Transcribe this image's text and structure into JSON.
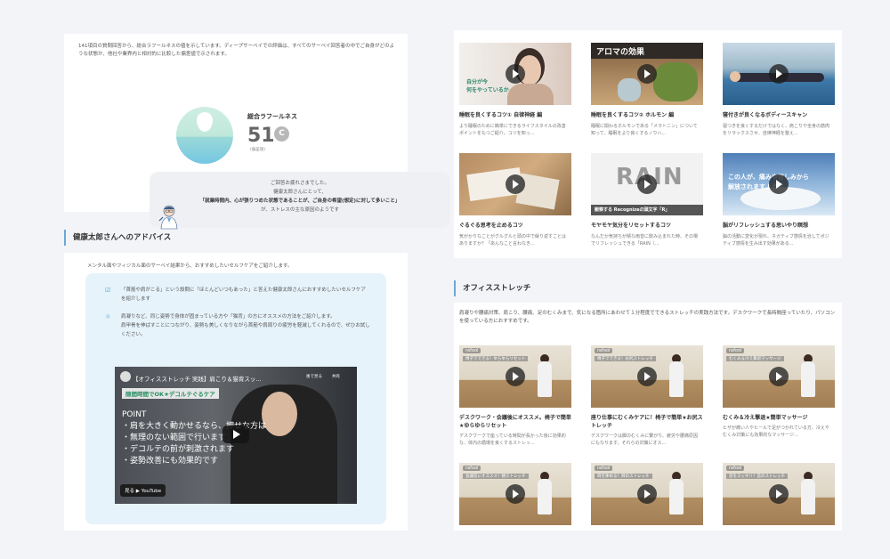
{
  "intro": {
    "description": "141項目の質問回答から、総合ラフールネスの値を示しています。ディープサーベイでの評価は、すべてのサーベイ回答者の中でご自身がどのような状態か、他社や業界内と相対的に比較した偏差値で示されます。",
    "score_label": "総合ラフールネス",
    "score_value": "51",
    "score_grade": "C",
    "score_sub": "(偏差値)",
    "message_line1": "ご回答お疲れさまでした。",
    "message_line2": "健康太郎さんにとって、",
    "message_line3": "「就業時間内、心が張りつめた状態であることが、ご自身の希望(想定)に対して多いこと」",
    "message_line4": "が、ストレスの主な原因のようです"
  },
  "advice": {
    "heading": "健康太郎さんへのアドバイス",
    "intro": "メンタル面やフィジカル面のサーベイ結果から、おすすめしたいセルフケアをご紹介します。",
    "item1": "「首筋や肩がこる」という設問に「ほとんどいつもあった」と答えた健康太郎さんにおすすめしたいセルフケアを紹介します",
    "item2_line1": "肩凝りなど、同じ姿勢で身体が固まっている方や「猫背」の方にオススメの方法をご紹介します。",
    "item2_line2": "肩甲骨を伸ばすことにつながり、姿勢も美しくなりながら首筋や肩周りの疲労を軽減してくれるので、ぜひお試しください。",
    "video": {
      "title": "【オフィスストレッチ 実践】肩こり＆猫背スッ...",
      "tag": "隙間時間でOK★デコルテぐるケア",
      "point_head": "POINT",
      "point1": "・肩を大きく動かせるなら、押せな方は",
      "point2": "・無理のない範囲で行います",
      "point3": "・デコルテの前が刺激されます",
      "point4": "・姿勢改善にも効果的です",
      "watch_later": "後で見る",
      "share": "共有",
      "watch_on": "見る ▶ YouTube"
    }
  },
  "videos": [
    {
      "title": "睡眠を良くするコツ① 自律神経 編",
      "desc": "より睡眠のために簡単にできるライフスタイルの改善ポイントをもつご紹介。コツを知っ..."
    },
    {
      "title": "睡眠を良くするコツ② ホルモン 編",
      "desc": "睡眠に関わるホルモンである「メラトニン」について知って、睡眠をより良くするノウハ..."
    },
    {
      "title": "寝付きが良くなるボディースキャン",
      "desc": "寝つきを良くするだけではなく、肩こりや全身の筋肉をリラックスさせ、自律神経を整え..."
    },
    {
      "title": "ぐるぐる思考を止めるコツ",
      "desc": "気がかりなことがグルグルと頭の中で繰り返すことはありますか？「あんなこと言わなき..."
    },
    {
      "title": "モヤモヤ気分をリセットするコツ",
      "desc": "なんだか気持ちが晴な雨音に飲み込まれた時、その場でリフレッシュできる「RAIN（..."
    },
    {
      "title": "脳がリフレッシュする思いやり瞑想",
      "desc": "脳の活動に変化が現れ、ネガティブ感情を治してポジティブ感情を生み出す効果がある..."
    }
  ],
  "video_overlays": {
    "v1_text": "自分が今\n何をやっているか",
    "v2_text": "アロマの効果",
    "v5_text": "RAIN",
    "v5_sub": "観察する Recognizeの頭文字「R」",
    "v6_text": "この人が、痛みや苦しみから\n解放されますように"
  },
  "stretch": {
    "heading": "オフィスストレッチ",
    "intro": "肩凝りや腰痛対策、肩こり、腰痛、足のむくみまで、気になる箇所にあわせて１分程度でできるストレッチの実践方法です。デスクワークで長時間座っていたり、パソコンを使っている方におすすめです。",
    "badge": "rafool",
    "items": [
      {
        "title": "デスクワーク・会議後にオススメ。椅子で簡単★ゆらゆらリセット",
        "desc": "デスクワークで座っている時間が長かった後に効果的な、体内の循環を良くするストレッ...",
        "label": "椅子でできる！ゆらゆらリセット"
      },
      {
        "title": "座り仕事にむくみケアに！椅子で簡単★お尻ストレッチ",
        "desc": "デスクワークは脚のむくみに繋がり、疲労や腰痛原因にもなります。それらの対策にオス...",
        "label": "椅子でできる！お尻ストレッチ"
      },
      {
        "title": "むくみ＆冷え撃退★簡単マッサージ",
        "desc": "ヒザが痛い人やヒールで足がつかれている方、冷えやむくみ対策にも効果的なマッサージ...",
        "label": "むくみ＆冷え撃退マッサージ"
      },
      {
        "label": "会議前にオススメ！朝ストレッチ"
      },
      {
        "label": "目を休める！目のストレッチ"
      },
      {
        "label": "首をスッキリ！首のストレッチ"
      }
    ]
  }
}
